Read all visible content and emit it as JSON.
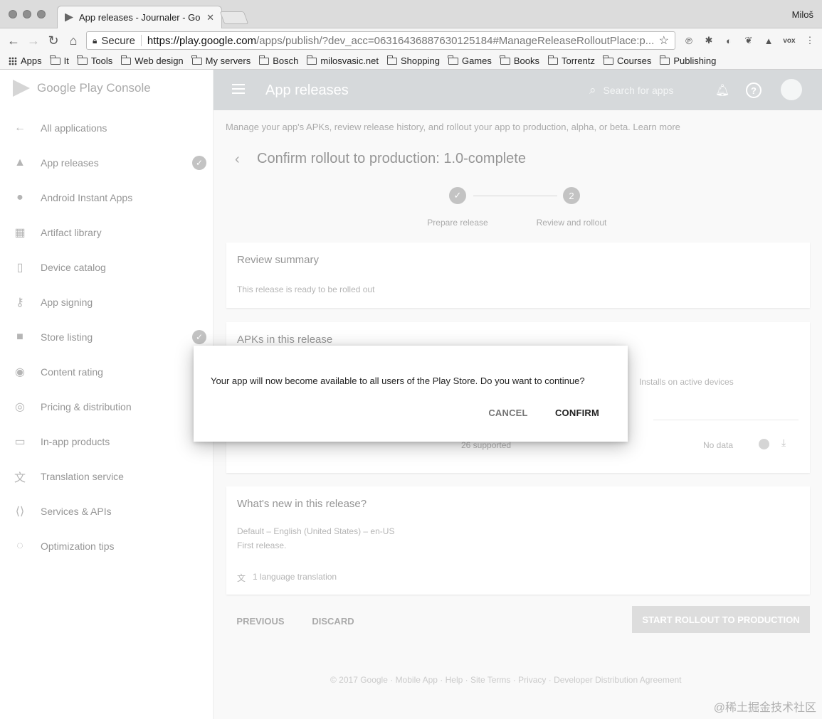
{
  "browser": {
    "tab_title": "App releases - Journaler - Goo",
    "profile_name": "Miloš",
    "secure_label": "Secure",
    "url_host": "https://play.google.com",
    "url_rest": "/apps/publish/?dev_acc=06316436887630125184#ManageReleaseRolloutPlace:p...",
    "bookmarks": [
      "Apps",
      "It",
      "Tools",
      "Web design",
      "My servers",
      "Bosch",
      "milosvasic.net",
      "Shopping",
      "Games",
      "Books",
      "Torrentz",
      "Courses",
      "Publishing"
    ],
    "ext_vox": "vox"
  },
  "sidebar": {
    "brand": "Google Play Console",
    "items": [
      {
        "label": "All applications"
      },
      {
        "label": "App releases"
      },
      {
        "label": "Android Instant Apps"
      },
      {
        "label": "Artifact library"
      },
      {
        "label": "Device catalog"
      },
      {
        "label": "App signing"
      },
      {
        "label": "Store listing"
      },
      {
        "label": "Content rating"
      },
      {
        "label": "Pricing & distribution"
      },
      {
        "label": "In-app products"
      },
      {
        "label": "Translation service"
      },
      {
        "label": "Services & APIs"
      },
      {
        "label": "Optimization tips"
      }
    ]
  },
  "header": {
    "title": "App releases",
    "search_placeholder": "Search for apps"
  },
  "main": {
    "intro": "Manage your app's APKs, review release history, and rollout your app to production, alpha, or beta.",
    "learn_more": "Learn more",
    "page_title": "Confirm rollout to production: 1.0-complete",
    "steps": [
      {
        "label": "Prepare release",
        "mark": "✓"
      },
      {
        "label": "Review and rollout",
        "mark": "2"
      }
    ],
    "review": {
      "title": "Review summary",
      "text": "This release is ready to be rolled out"
    },
    "apks": {
      "title": "APKs in this release",
      "col_installs": "Installs on active devices",
      "row_version": "26 supported",
      "row_nodata": "No data"
    },
    "whats_new": {
      "title": "What's new in this release?",
      "locale": "Default – English (United States) – en-US",
      "text": "First release.",
      "translation": "1 language translation"
    },
    "buttons": {
      "previous": "PREVIOUS",
      "discard": "DISCARD",
      "start": "START ROLLOUT TO PRODUCTION"
    },
    "footer": "© 2017 Google · Mobile App · Help · Site Terms · Privacy · Developer Distribution Agreement"
  },
  "dialog": {
    "message": "Your app will now become available to all users of the Play Store. Do you want to continue?",
    "cancel": "CANCEL",
    "confirm": "CONFIRM"
  },
  "watermark": "@稀土掘金技术社区"
}
